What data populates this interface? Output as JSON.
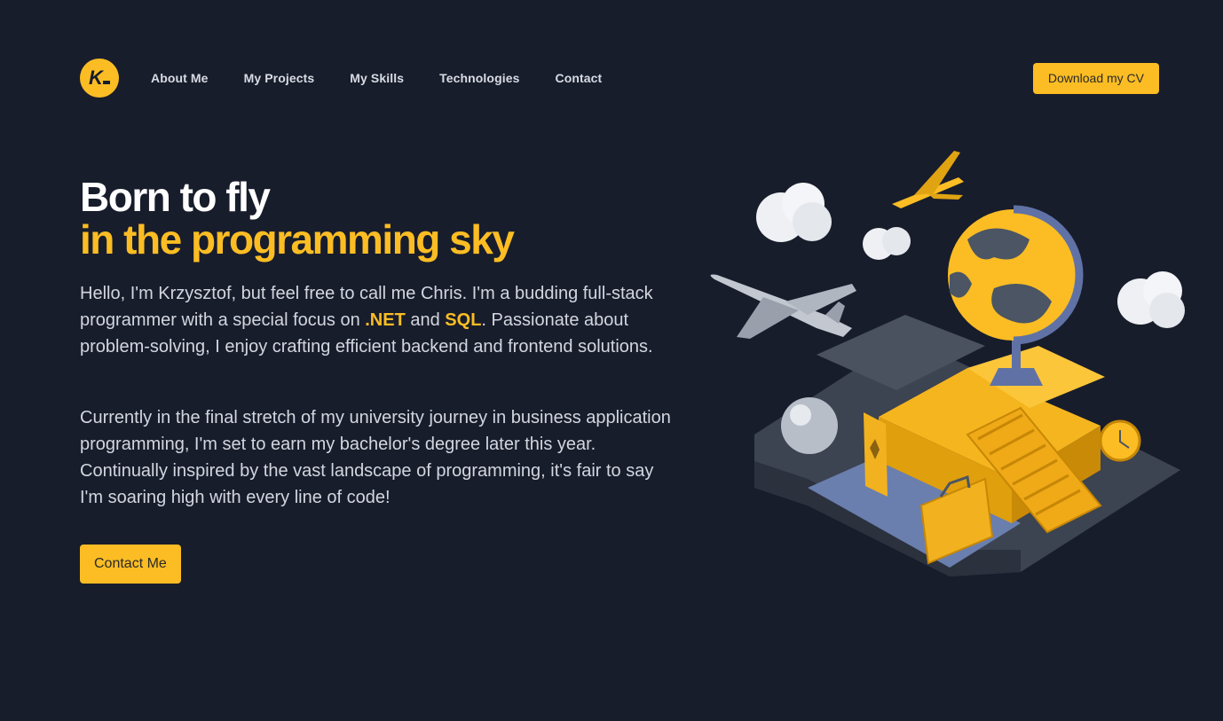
{
  "nav": {
    "logo_text": "K",
    "links": [
      "About Me",
      "My Projects",
      "My Skills",
      "Technologies",
      "Contact"
    ],
    "cv_button": "Download my CV"
  },
  "hero": {
    "title_line1": "Born to fly",
    "title_line2": "in the programming sky",
    "p1_before": "Hello, I'm Krzysztof, but feel free to call me Chris. I'm a budding full-stack programmer with a special focus on ",
    "p1_hl1": ".NET",
    "p1_mid": " and ",
    "p1_hl2": "SQL",
    "p1_after": ". Passionate about problem-solving, I enjoy crafting efficient backend and frontend solutions.",
    "p2": "Currently in the final stretch of my university journey in business application programming, I'm set to earn my bachelor's degree later this year. Continually inspired by the vast landscape of programming, it's fair to say I'm soaring high with every line of code!",
    "contact_button": "Contact Me"
  },
  "colors": {
    "background": "#181d2c",
    "accent": "#fbbd23",
    "text": "#d3d6de"
  },
  "illustration": {
    "icons": [
      "airplane-icon",
      "globe-icon",
      "cloud-icon",
      "ticket-icon",
      "suitcase-icon",
      "clock-icon",
      "escalator-icon",
      "sphere-icon"
    ]
  }
}
